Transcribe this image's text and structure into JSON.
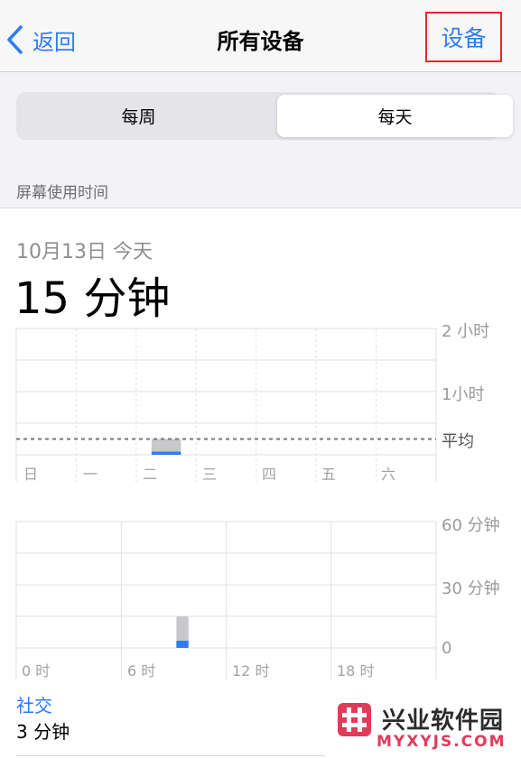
{
  "nav": {
    "back_label": "返回",
    "title": "所有设备",
    "devices_label": "设备"
  },
  "segmented": {
    "weekly_label": "每周",
    "daily_label": "每天",
    "selected": "每天"
  },
  "section_header": "屏幕使用时间",
  "summary": {
    "date": "10月13日 今天",
    "total": "15 分钟"
  },
  "chart_data": [
    {
      "type": "bar",
      "categories": [
        "日",
        "一",
        "二",
        "三",
        "四",
        "五",
        "六"
      ],
      "series": [
        {
          "values": [
            0,
            0,
            0.05,
            0,
            0,
            0,
            0
          ]
        },
        {
          "values": [
            0,
            0,
            0.25,
            0,
            0,
            0,
            0
          ]
        }
      ],
      "ylim": [
        0,
        2
      ],
      "y_ticks": [
        "2 小时",
        "1小时"
      ],
      "average_label": "平均",
      "average_value": 0.25
    },
    {
      "type": "bar",
      "x_ticks": [
        "0 时",
        "6 时",
        "12 时",
        "18 时"
      ],
      "hour_bins": 24,
      "series": [
        {
          "values": [
            0,
            0,
            0,
            0,
            0,
            0,
            0,
            0,
            0,
            2,
            0,
            0,
            0,
            0,
            0,
            0,
            0,
            0,
            0,
            0,
            0,
            0,
            0,
            0
          ]
        },
        {
          "values": [
            0,
            0,
            0,
            0,
            0,
            0,
            0,
            0,
            0,
            15,
            0,
            0,
            0,
            0,
            0,
            0,
            0,
            0,
            0,
            0,
            0,
            0,
            0,
            0
          ]
        }
      ],
      "ylim": [
        0,
        60
      ],
      "y_ticks": [
        "60 分钟",
        "30 分钟",
        "0"
      ]
    }
  ],
  "category": {
    "name": "社交",
    "time": "3 分钟"
  },
  "colors": {
    "accent": "#2e7cf6",
    "bar_gray": "#c7c7cc",
    "highlight_border": "#e02b2b"
  },
  "watermark": {
    "title": "兴业软件园",
    "url": "MYXYJS.COM"
  }
}
